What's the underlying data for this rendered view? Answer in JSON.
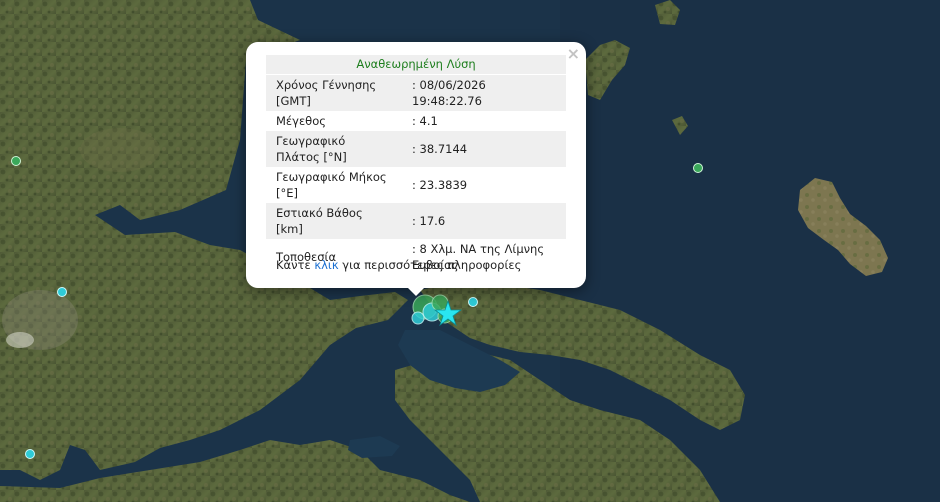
{
  "map": {
    "type": "satellite",
    "region": "Central Greece / Evia"
  },
  "epicenter": {
    "lat": 38.7144,
    "lon": 23.3839,
    "marker": "star-icon",
    "color": "#29e6f0"
  },
  "popup": {
    "title": "Αναθεωρημένη Λύση",
    "close_label": "×",
    "rows": [
      {
        "key": "Χρόνος Γέννησης [GMT]",
        "value": ": 08/06/2026 19:48:22.76"
      },
      {
        "key": "Μέγεθος",
        "value": ": 4.1"
      },
      {
        "key": "Γεωγραφικό Πλάτος [°N]",
        "value": ": 38.7144"
      },
      {
        "key": "Γεωγραφικό Μήκος [°E]",
        "value": ": 23.3839"
      },
      {
        "key": "Εστιακό Βάθος [km]",
        "value": ": 17.6"
      },
      {
        "key": "Τοποθεσία",
        "value": ": 8 Χλμ. ΝΑ της Λίμνης Ευβοίας"
      }
    ],
    "more_prefix": "Κάντε",
    "more_link": "κλικ",
    "more_suffix": "για περισσότερες πληροφορίες"
  },
  "colors": {
    "sea": "#1b3349",
    "popup_title": "#1e7e1e",
    "link": "#1a6fd1",
    "quake_recent": "#2ecbd6",
    "quake_older": "#3aa85a"
  }
}
